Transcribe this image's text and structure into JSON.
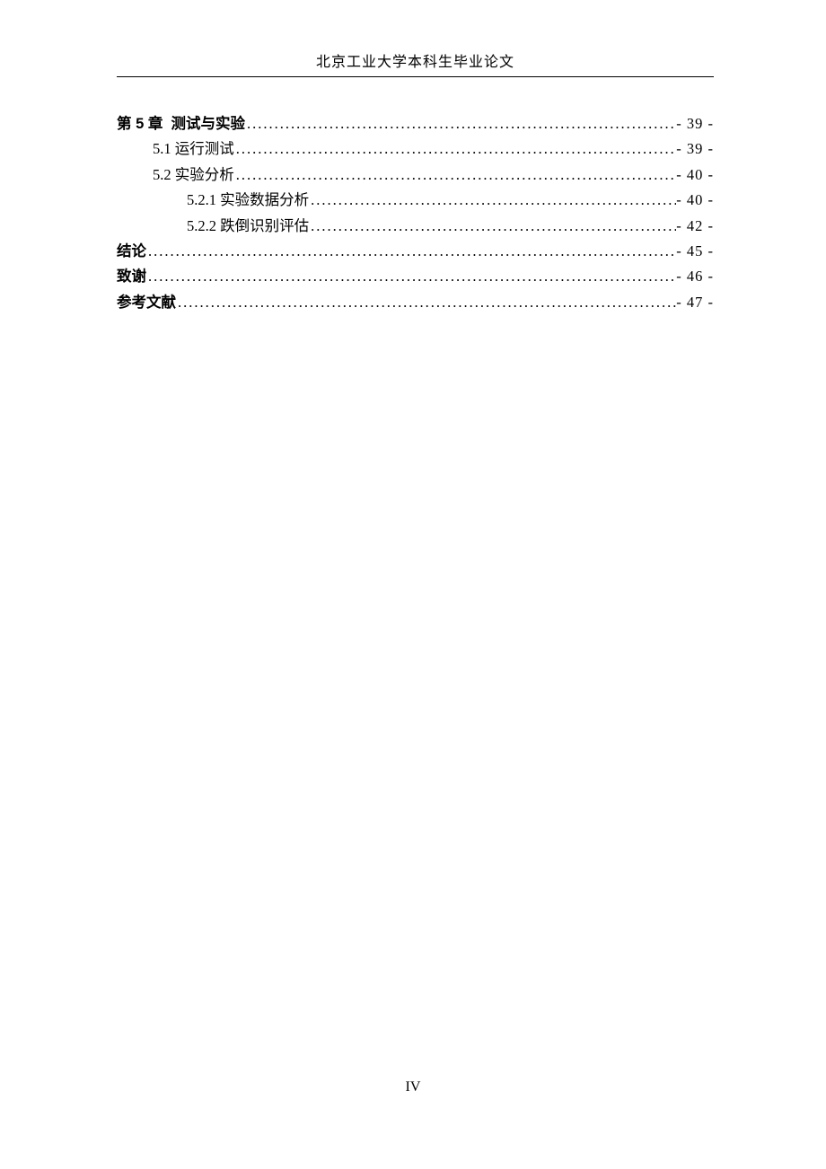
{
  "header": {
    "title": "北京工业大学本科生毕业论文"
  },
  "toc": {
    "entries": [
      {
        "level": 0,
        "bold": true,
        "label": "第 5 章  测试与实验",
        "page": "- 39 -"
      },
      {
        "level": 1,
        "bold": false,
        "label": "5.1 运行测试",
        "page": "- 39 -"
      },
      {
        "level": 1,
        "bold": false,
        "label": "5.2 实验分析",
        "page": "- 40 -"
      },
      {
        "level": 2,
        "bold": false,
        "label": "5.2.1 实验数据分析 ",
        "page": "- 40 -"
      },
      {
        "level": 2,
        "bold": false,
        "label": "5.2.2 跌倒识别评估 ",
        "page": "- 42 -"
      },
      {
        "level": 0,
        "bold": true,
        "label": "结论",
        "page": "- 45 -"
      },
      {
        "level": 0,
        "bold": true,
        "label": "致谢",
        "page": "- 46 -"
      },
      {
        "level": 0,
        "bold": true,
        "label": "参考文献",
        "page": "- 47 -"
      }
    ]
  },
  "footer": {
    "page_number": "IV"
  },
  "dots": "..........................................................................................................."
}
